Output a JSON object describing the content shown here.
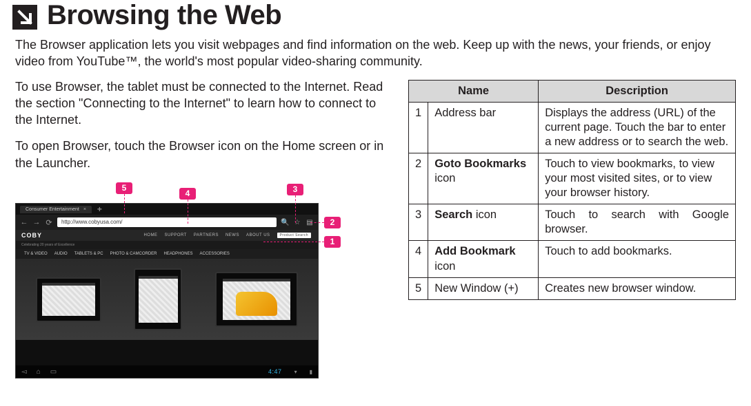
{
  "header": {
    "title": "Browsing the Web",
    "icon": "arrow-down-right-icon"
  },
  "intro": "The Browser application lets you visit webpages and find information on the web. Keep up with the news, your friends, or enjoy video from YouTube™, the world's most popular video-sharing community.",
  "left": {
    "para1": "To use Browser, the tablet must be connected to the Internet. Read the section \"Connecting to the Internet\" to learn how to connect to the Internet.",
    "para2": "To open Browser, touch the Browser icon on the Home screen or in the Launcher.",
    "callouts": [
      "5",
      "4",
      "3",
      "2",
      "1"
    ],
    "mock": {
      "tab_label": "Consumer Entertainment",
      "plus": "+",
      "url": "http://www.cobyusa.com/",
      "logo": "COBY",
      "top_menu": [
        "HOME",
        "SUPPORT",
        "PARTNERS",
        "NEWS",
        "ABOUT US"
      ],
      "product_search": "Product Search",
      "tagline": "Celebrating 20 years of Excellence",
      "categories": [
        "TV & VIDEO",
        "AUDIO",
        "TABLETS & PC",
        "PHOTO & CAMCORDER",
        "HEADPHONES",
        "ACCESSORIES"
      ],
      "clock": "4:47"
    }
  },
  "table": {
    "headers": {
      "name": "Name",
      "desc": "Description"
    },
    "rows": [
      {
        "n": "1",
        "name_plain": "Address bar",
        "desc_plain": "Displays the address (URL) of the current page. Touch the bar to enter a new address or to search the web."
      },
      {
        "n": "2",
        "name_bold": "Goto Bookmarks",
        "name_after": "icon",
        "desc_plain": "Touch to view bookmarks, to view your most visited sites, or to view your browser history."
      },
      {
        "n": "3",
        "name_bold": "Search",
        "name_after_inline": " icon",
        "desc_justify": "Touch to search with Google browser.",
        "desc_l1": "Touch to search with Google",
        "desc_l2": "browser."
      },
      {
        "n": "4",
        "name_bold": "Add Bookmark",
        "name_after": "icon",
        "desc_plain": "Touch to add bookmarks."
      },
      {
        "n": "5",
        "name_plain": "New Window (+)",
        "desc_plain": "Creates new browser window."
      }
    ]
  }
}
